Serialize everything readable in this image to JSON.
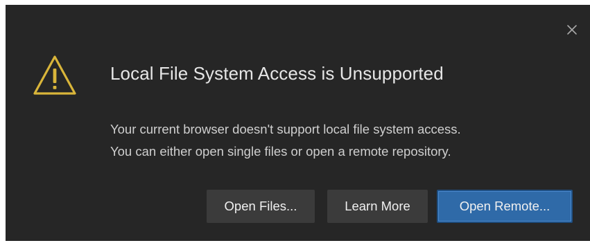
{
  "dialog": {
    "title": "Local File System Access is Unsupported",
    "message_line1": "Your current browser doesn't support local file system access.",
    "message_line2": "You can either open single files or open a remote repository.",
    "close_icon": "close-icon",
    "warning_icon": "warning-triangle-icon",
    "warning_color": "#d9b53a"
  },
  "buttons": {
    "open_files": "Open Files...",
    "learn_more": "Learn More",
    "open_remote": "Open Remote..."
  },
  "colors": {
    "background": "#262626",
    "primary_button": "#2f6aa8",
    "secondary_button": "#3b3b3b"
  }
}
